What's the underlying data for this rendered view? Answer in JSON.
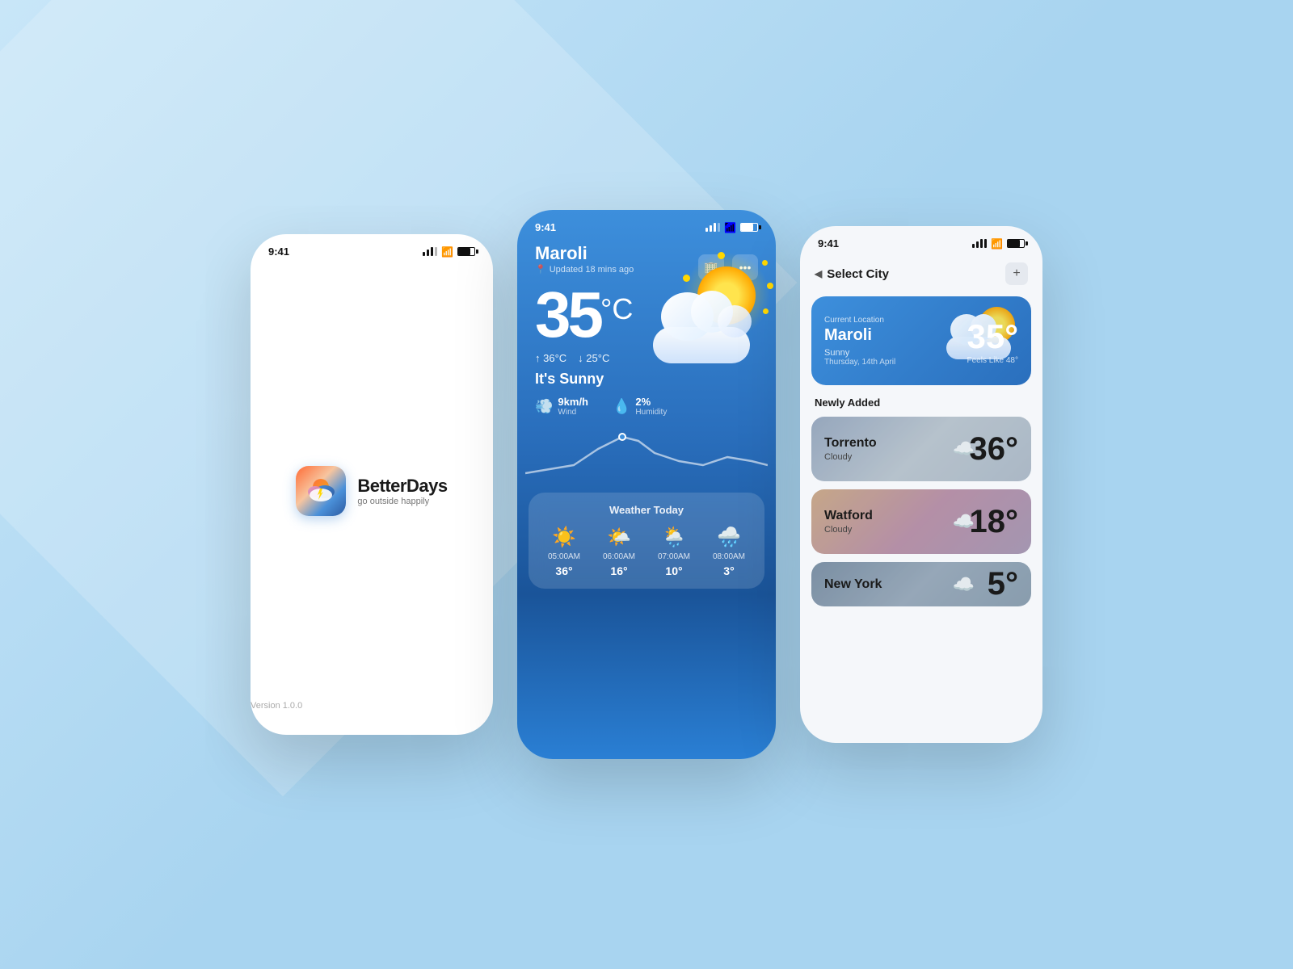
{
  "background": "#a8d4f0",
  "phone_splash": {
    "status_time": "9:41",
    "logo_emoji": "⛅",
    "app_name": "BetterDays",
    "tagline": "go outside happily",
    "version": "Version 1.0.0"
  },
  "phone_main": {
    "status_time": "9:41",
    "city": "Maroli",
    "updated": "Updated 18 mins ago",
    "temperature": "35",
    "temp_unit": "°C",
    "temp_high": "36°C",
    "temp_low": "25°C",
    "condition": "It's Sunny",
    "wind_speed": "9km/h",
    "wind_label": "Wind",
    "humidity": "2%",
    "humidity_label": "Humidity",
    "panel_title": "Weather Today",
    "hourly": [
      {
        "time": "05:00AM",
        "icon": "☀️",
        "temp": "36°"
      },
      {
        "time": "06:00AM",
        "icon": "🌤️",
        "temp": "16°"
      },
      {
        "time": "07:00AM",
        "icon": "🌦️",
        "temp": "10°"
      },
      {
        "time": "08:00AM",
        "icon": "🌧️",
        "temp": "3°"
      }
    ]
  },
  "phone_city": {
    "status_time": "9:41",
    "header_title": "Select City",
    "back_arrow": "◀",
    "add_button": "+",
    "current_card": {
      "label": "Current Location",
      "city": "Maroli",
      "temperature": "35°",
      "feels_like": "Feels Like 48°",
      "condition": "Sunny",
      "date": "Thursday, 14th April"
    },
    "newly_added_label": "Newly Added",
    "cities": [
      {
        "name": "Torrento",
        "condition": "Cloudy",
        "temp": "36°",
        "icon": "☁️",
        "style": "torrento"
      },
      {
        "name": "Watford",
        "condition": "Cloudy",
        "temp": "18°",
        "icon": "☁️",
        "style": "watford"
      },
      {
        "name": "New York",
        "condition": "Cloudy",
        "temp": "5°",
        "icon": "☁️",
        "style": "newyork"
      }
    ]
  }
}
